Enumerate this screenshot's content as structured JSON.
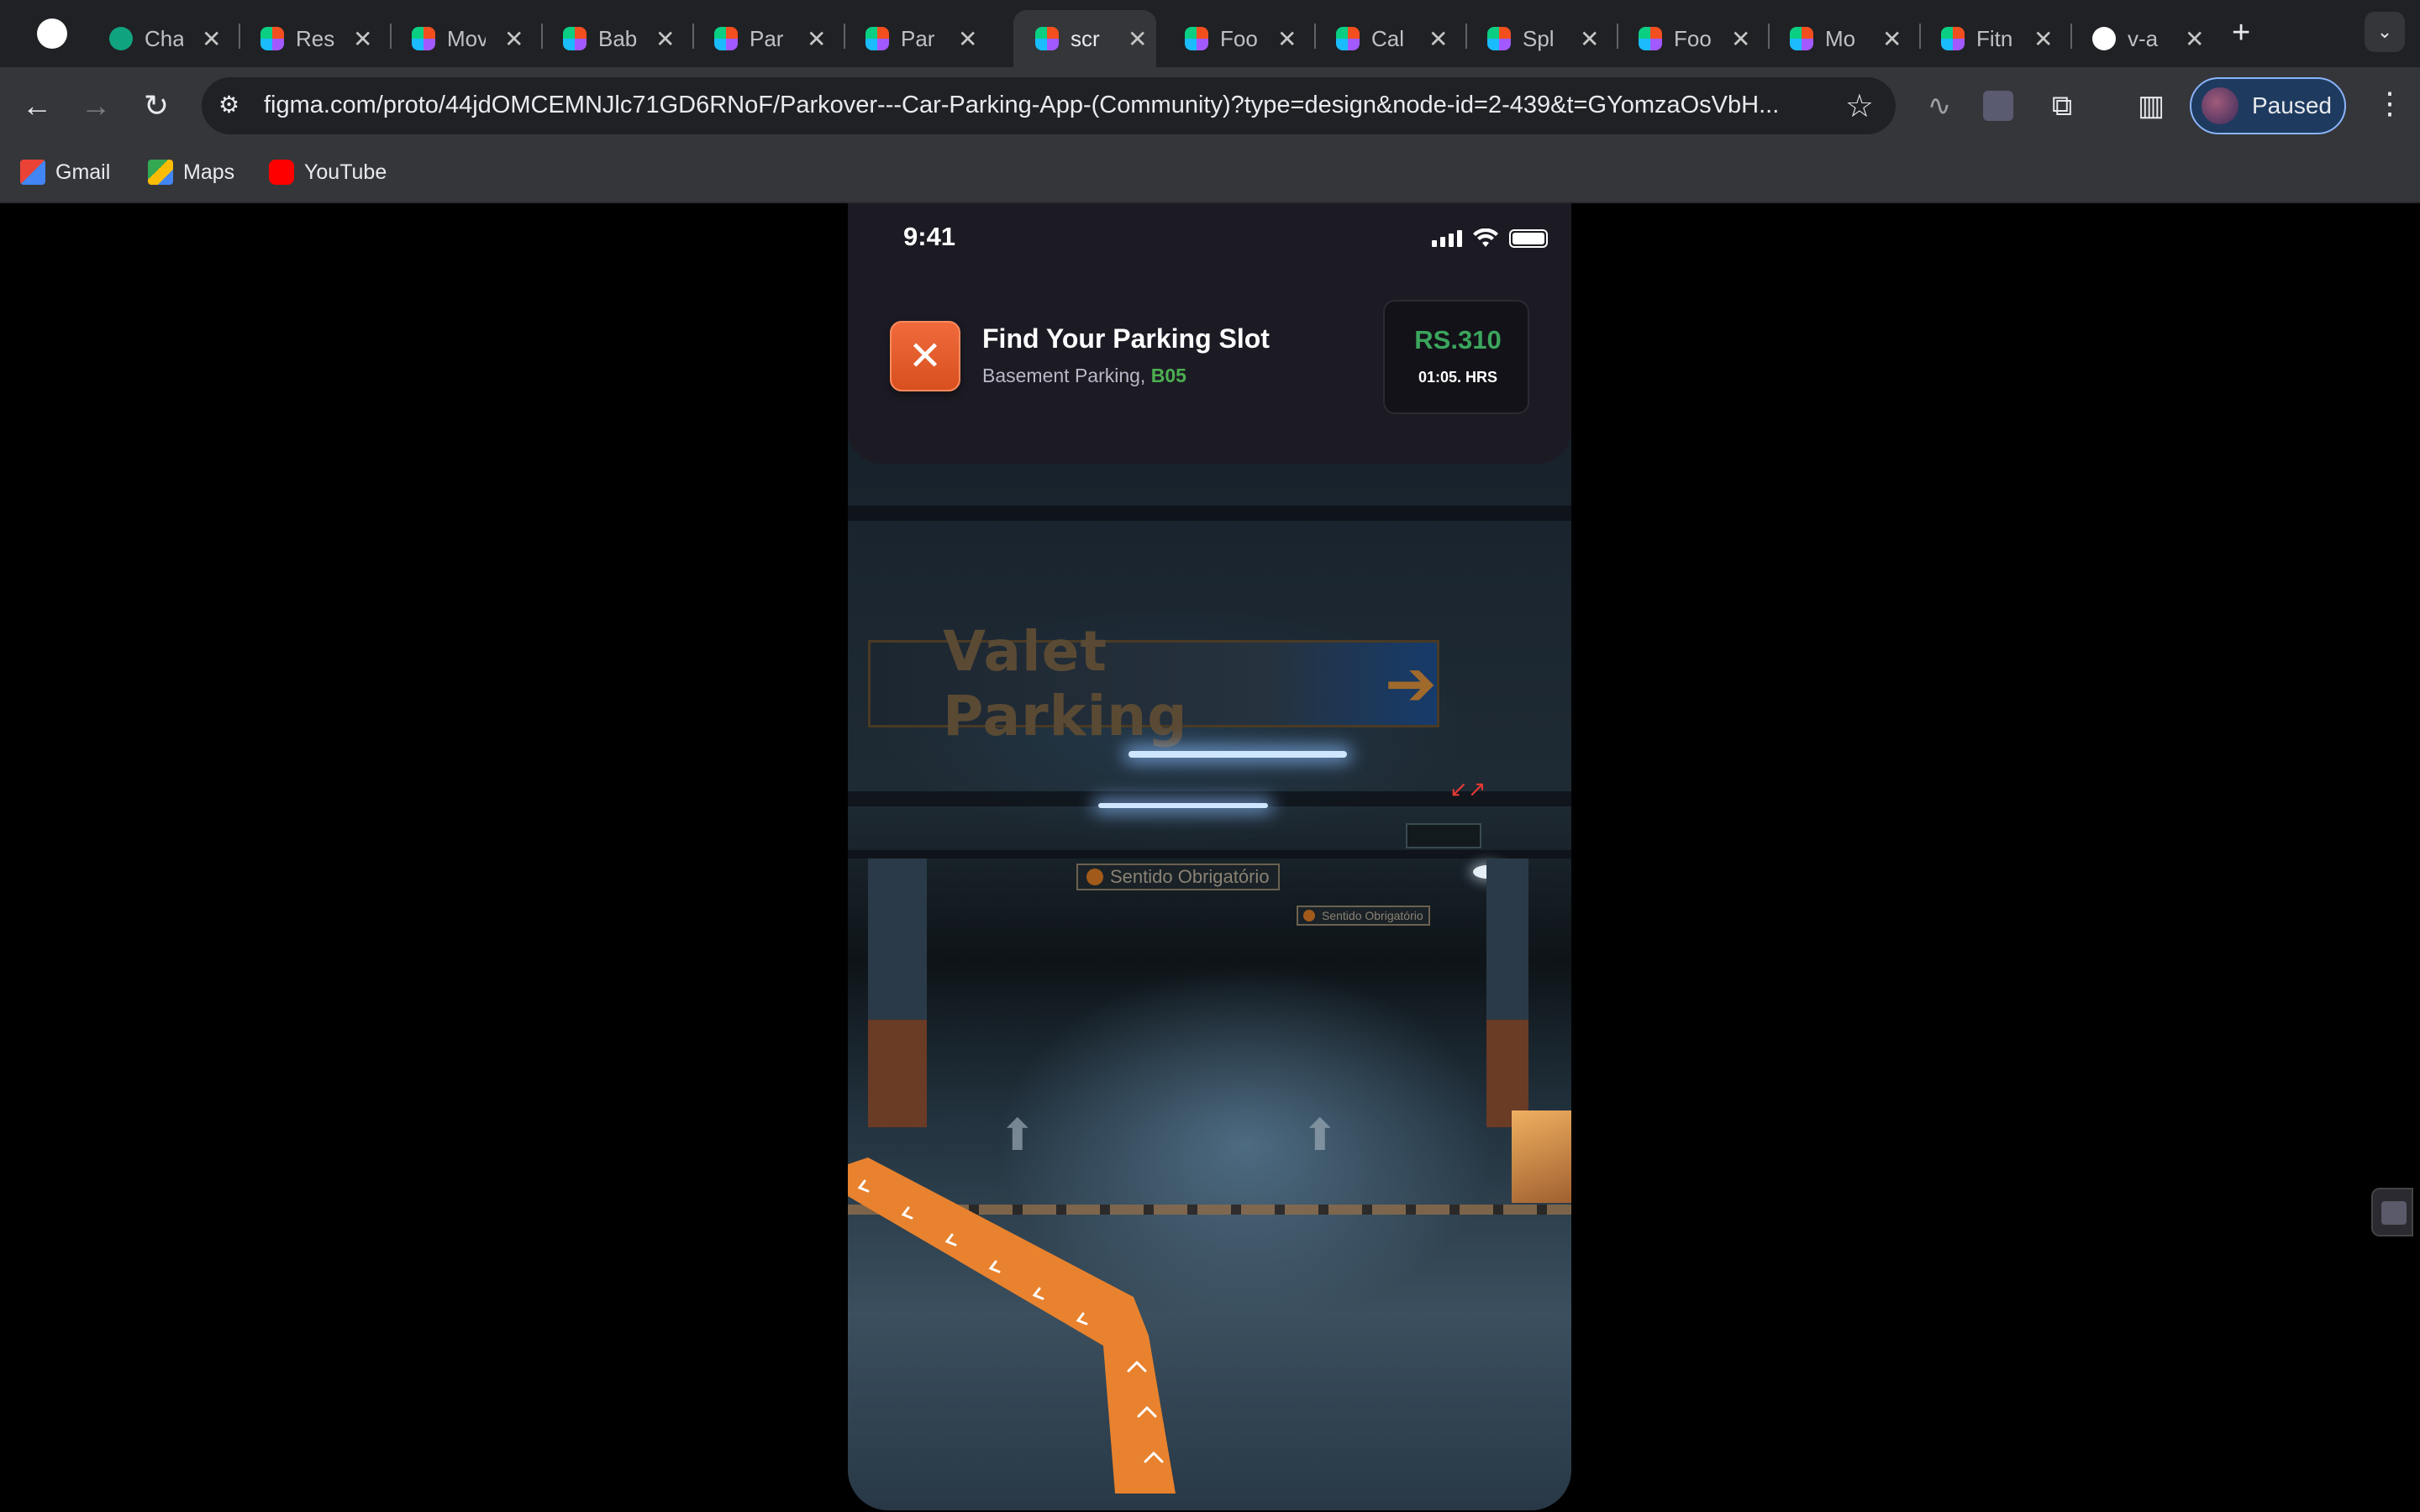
{
  "browser": {
    "tabs": [
      {
        "title": "Cha",
        "icon": "chatgpt-icon"
      },
      {
        "title": "Res",
        "icon": "figma-icon"
      },
      {
        "title": "Mov",
        "icon": "figma-icon"
      },
      {
        "title": "Bab",
        "icon": "figma-icon"
      },
      {
        "title": "Par",
        "icon": "figma-icon"
      },
      {
        "title": "Par",
        "icon": "figma-icon"
      },
      {
        "title": "scr",
        "icon": "figma-icon",
        "active": true
      },
      {
        "title": "Foo",
        "icon": "figma-icon"
      },
      {
        "title": "Cal",
        "icon": "figma-icon"
      },
      {
        "title": "Spl",
        "icon": "figma-icon"
      },
      {
        "title": "Foo",
        "icon": "figma-icon"
      },
      {
        "title": "Mo",
        "icon": "figma-icon"
      },
      {
        "title": "Fitn",
        "icon": "figma-icon"
      },
      {
        "title": "v-a",
        "icon": "github-icon"
      }
    ],
    "url": "figma.com/proto/44jdOMCEMNJlc71GD6RNoF/Parkover---Car-Parking-App-(Community)?type=design&node-id=2-439&t=GYomzaOsVbH...",
    "profile_label": "Paused",
    "bookmarks": [
      {
        "label": "Gmail",
        "icon": "gmail-icon"
      },
      {
        "label": "Maps",
        "icon": "maps-icon"
      },
      {
        "label": "YouTube",
        "icon": "youtube-icon"
      }
    ]
  },
  "app": {
    "status_time": "9:41",
    "header": {
      "title": "Find Your Parking Slot",
      "location_prefix": "Basement Parking,",
      "slot": "B05",
      "price": "RS.310",
      "duration": "01:05. HRS"
    },
    "scene_signs": {
      "valet_text": "Valet Parking",
      "sentido_large": "Sentido Obrigatório",
      "sentido_small": "Sentido Obrigatório"
    }
  },
  "colors": {
    "accent_orange": "#f06a3c",
    "price_green": "#3ba55c",
    "slot_green": "#4caf50",
    "route_orange": "#e8822e"
  }
}
